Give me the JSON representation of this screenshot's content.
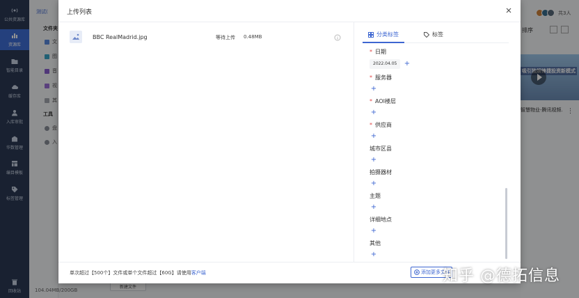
{
  "rail": {
    "items": [
      {
        "label": "公共资源库",
        "icon": "broadcast-icon"
      },
      {
        "label": "资源库",
        "icon": "chart-icon"
      },
      {
        "label": "智能目录",
        "icon": "folder-icon"
      },
      {
        "label": "缓存库",
        "icon": "cloud-icon"
      },
      {
        "label": "入库审批",
        "icon": "user-icon"
      },
      {
        "label": "华数管理",
        "icon": "building-icon"
      },
      {
        "label": "编目模板",
        "icon": "template-icon"
      },
      {
        "label": "标签管理",
        "icon": "tag-icon"
      }
    ],
    "bottom_label": "回收站"
  },
  "side2": {
    "crumb": "测试(",
    "section_files": "文件夹",
    "files": [
      "文",
      "图",
      "音",
      "视",
      "其"
    ],
    "section_tools": "工具",
    "tools": [
      "盘",
      "入"
    ]
  },
  "storage": "104.04MB/200GB",
  "new_folder": "新建文件",
  "background": {
    "member_count": "共3人",
    "sort_label": "排序",
    "thumb_banner": "吸引独娱锋捷投资新模式",
    "thumb_caption": "智慧物业-腾讯视频.",
    "colors": {
      "avatar1": "#d0843c",
      "avatar2": "#3a6f8f",
      "avatar3": "#56697a"
    }
  },
  "modal": {
    "title": "上传列表",
    "file": {
      "name": "BBC RealMadrid.jpg",
      "status": "等待上传",
      "size": "0.48MB"
    },
    "tabs": {
      "classify": "分类标签",
      "tags": "标签"
    },
    "fields": [
      {
        "label": "日期",
        "required": true,
        "chip": "2022.04.05"
      },
      {
        "label": "服务器",
        "required": true
      },
      {
        "label": "AOI楼层",
        "required": true
      },
      {
        "label": "供应商",
        "required": true
      },
      {
        "label": "城市区县",
        "required": false
      },
      {
        "label": "拍摄器材",
        "required": false
      },
      {
        "label": "主题",
        "required": false
      },
      {
        "label": "详细地点",
        "required": false
      },
      {
        "label": "其他",
        "required": false
      }
    ],
    "footer_note": "单次超过【500个】文件或单个文件超过【60G】请使用",
    "footer_link": "客户端",
    "add_more": "添加更多文件",
    "accent_color": "#3d66d1"
  },
  "watermark": "知乎 @德拓信息"
}
